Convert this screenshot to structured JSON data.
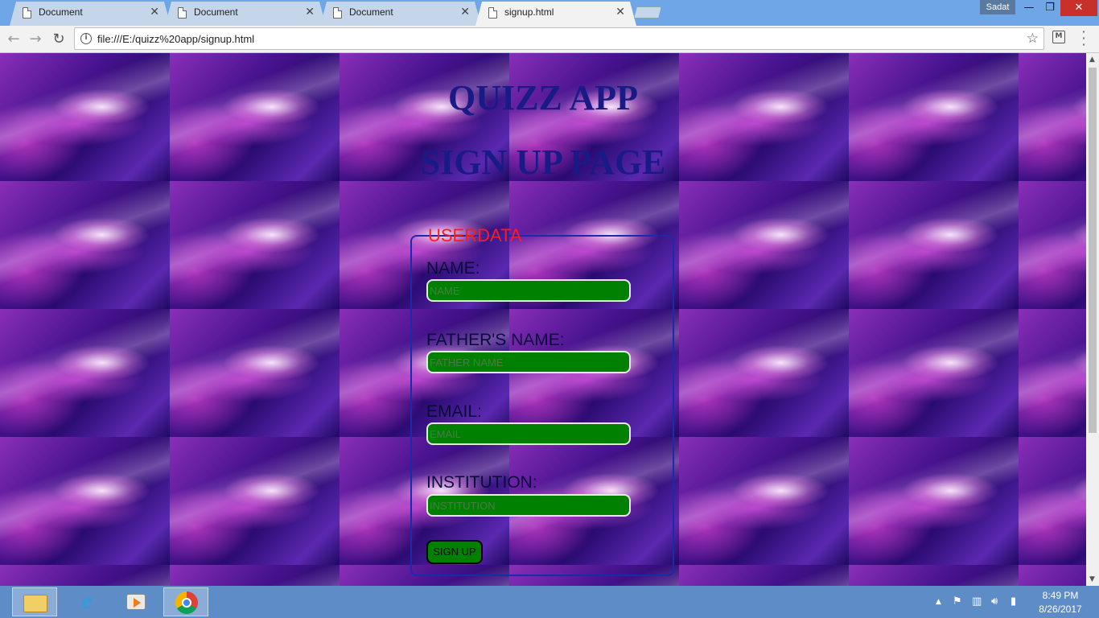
{
  "browser": {
    "tabs": [
      {
        "title": "Document",
        "active": false
      },
      {
        "title": "Document",
        "active": false
      },
      {
        "title": "Document",
        "active": false
      },
      {
        "title": "signup.html",
        "active": true
      }
    ],
    "user_badge": "Sadat",
    "address": "file:///E:/quizz%20app/signup.html"
  },
  "page": {
    "app_title": "QUIZZ APP",
    "page_heading": "SIGN UP PAGE",
    "form": {
      "legend": "USERDATA",
      "fields": [
        {
          "label": "NAME:",
          "placeholder": "NAME",
          "value": ""
        },
        {
          "label": "FATHER'S NAME:",
          "placeholder": "FATHER NAME",
          "value": ""
        },
        {
          "label": "EMAIL:",
          "placeholder": "EMAIL",
          "value": ""
        },
        {
          "label": "INSTITUTION:",
          "placeholder": "INSTITUTION",
          "value": ""
        }
      ],
      "submit_label": "SIGN UP"
    }
  },
  "taskbar": {
    "time": "8:49 PM",
    "date": "8/26/2017"
  },
  "colors": {
    "heading": "#1a1a86",
    "legend": "#ff1a1a",
    "input_bg": "#008000",
    "fieldset_border": "#1a2aa8",
    "taskbar": "#5d8cc6",
    "tabstrip": "#6ea6e8"
  }
}
